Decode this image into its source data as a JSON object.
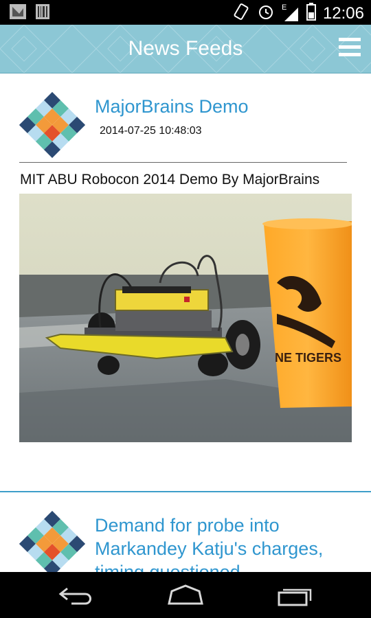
{
  "status_bar": {
    "time": "12:06",
    "network_type": "E",
    "icons": [
      "notification-icon",
      "barcode-icon",
      "vibrate-icon",
      "alarm-icon",
      "signal-icon",
      "battery-icon"
    ]
  },
  "app_bar": {
    "title": "News Feeds",
    "menu_icon": "hamburger-menu-icon",
    "color": "#8cc7d5"
  },
  "feed": {
    "items": [
      {
        "title": "MajorBrains Demo",
        "date": "2014-07-25 10:48:03",
        "description": "MIT ABU Robocon 2014 Demo By MajorBrains",
        "cup_text": "NE TIGERS",
        "logo": "majorbrains-logo"
      },
      {
        "title": "Demand for probe into Markandey Katju's charges, timing questioned",
        "logo": "majorbrains-logo"
      }
    ]
  },
  "nav_bar": {
    "icons": [
      "back-icon",
      "home-icon",
      "recent-apps-icon"
    ]
  },
  "colors": {
    "accent": "#2f96cf",
    "divider": "#3d9ec9",
    "logo_dark": "#2b4a73",
    "logo_teal": "#5fbfae",
    "logo_light": "#b7dcf0",
    "logo_orange": "#f39a3a",
    "logo_red": "#e4512b"
  }
}
